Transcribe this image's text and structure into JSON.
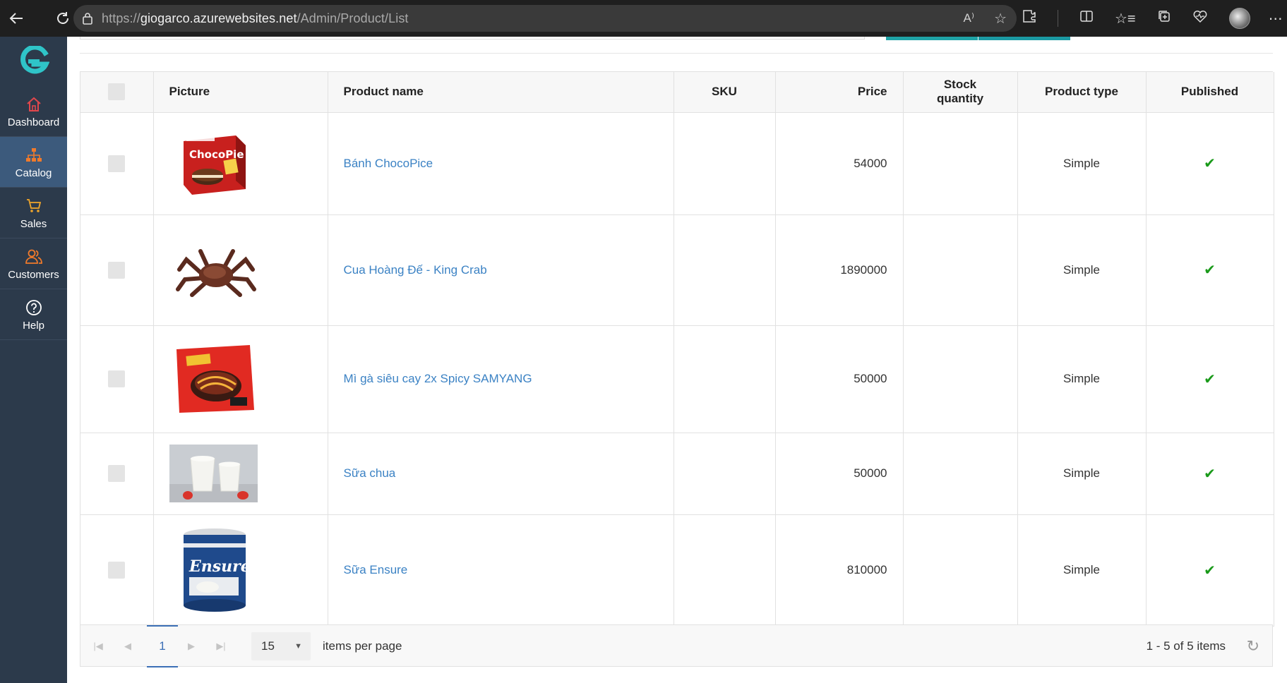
{
  "browser": {
    "url_scheme": "https://",
    "url_host": "giogarco.azurewebsites.net",
    "url_path": "/Admin/Product/List",
    "read_aloud_label": "A⁾"
  },
  "sidebar": {
    "items": [
      {
        "label": "Dashboard",
        "icon": "home-icon",
        "color": "#e0474c"
      },
      {
        "label": "Catalog",
        "icon": "sitemap-icon",
        "color": "#f07a2b"
      },
      {
        "label": "Sales",
        "icon": "cart-icon",
        "color": "#f0a62b"
      },
      {
        "label": "Customers",
        "icon": "users-icon",
        "color": "#f07a2b"
      },
      {
        "label": "Help",
        "icon": "help-icon",
        "color": "#ffffff"
      }
    ]
  },
  "table": {
    "headers": {
      "picture": "Picture",
      "name": "Product name",
      "sku": "SKU",
      "price": "Price",
      "stock": "Stock quantity",
      "type": "Product type",
      "published": "Published"
    },
    "rows": [
      {
        "name": "Bánh ChocoPice",
        "sku": "",
        "price": "54000",
        "stock": "",
        "type": "Simple",
        "published": "✔",
        "image": "chocopie-box"
      },
      {
        "name": "Cua Hoàng Đế - King Crab",
        "sku": "",
        "price": "1890000",
        "stock": "",
        "type": "Simple",
        "published": "✔",
        "image": "king-crab"
      },
      {
        "name": "Mì gà siêu cay 2x Spicy SAMYANG",
        "sku": "",
        "price": "50000",
        "stock": "",
        "type": "Simple",
        "published": "✔",
        "image": "samyang-pack"
      },
      {
        "name": "Sữa chua",
        "sku": "",
        "price": "50000",
        "stock": "",
        "type": "Simple",
        "published": "✔",
        "image": "yogurt-jars"
      },
      {
        "name": "Sữa Ensure",
        "sku": "",
        "price": "810000",
        "stock": "",
        "type": "Simple",
        "published": "✔",
        "image": "ensure-can"
      }
    ]
  },
  "pager": {
    "current_page": "1",
    "page_size": "15",
    "items_per_page_label": "items per page",
    "info": "1 - 5 of 5 items"
  },
  "colors": {
    "sidebar_bg": "#2c3a4b",
    "sidebar_active": "#3c5a7c",
    "accent_teal": "#1fa3a6",
    "link_blue": "#3b82c4",
    "published_green": "#1a9a1a"
  }
}
